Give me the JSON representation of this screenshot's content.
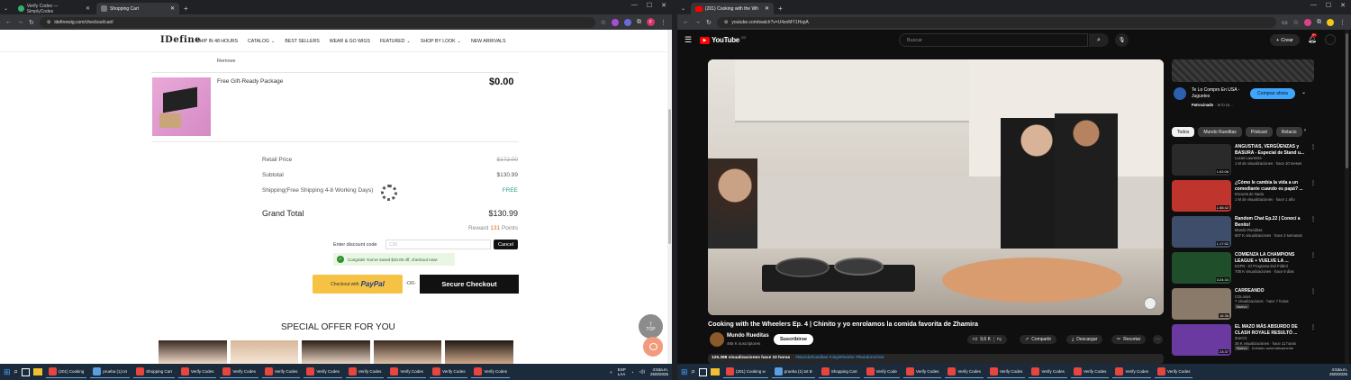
{
  "left_window": {
    "tabs": [
      {
        "title": "Verify Codes — SimplyCodes"
      },
      {
        "title": "Shopping Cart"
      }
    ],
    "url": "idefinewig.com/checkout/cart/",
    "profile_initial": "F"
  },
  "site": {
    "logo": "IDefine",
    "nav": [
      "SHIP IN 48 HOURS",
      "CATALOG",
      "BEST SELLERS",
      "WEAR & GO WIGS",
      "FEATURED",
      "SHOP BY LOOK",
      "NEW ARRIVALS"
    ]
  },
  "cart": {
    "remove_label": "Remove",
    "item_name": "Free Gift-Ready Package",
    "item_price": "$0.00",
    "retail_label": "Retail Price",
    "retail_value": "$172.00",
    "subtotal_label": "Subtotal",
    "subtotal_value": "$130.99",
    "shipping_label": "Shipping(Free Shipping 4-8 Working Days)",
    "shipping_value": "FREE",
    "grand_label": "Grand Total",
    "grand_value": "$130.99",
    "reward_prefix": "Reward",
    "reward_points": "131",
    "reward_suffix": "Points",
    "discount_label": "Enter discount code",
    "discount_value": "C30",
    "cancel_label": "Cancel",
    "success_msg": "Congrats! You've saved $10.00 off, checkout now!",
    "paypal_prefix": "Checkout with",
    "paypal_brand": "PayPal",
    "or_label": "-OR-",
    "checkout_label": "Secure Checkout",
    "special_offer": "SPECIAL OFFER FOR YOU",
    "top_label": "TOP"
  },
  "right_window": {
    "tabs": [
      {
        "title": "(201) Cooking with the Wh"
      }
    ],
    "url": "youtube.com/watch?v=U4znMY1HxpA",
    "notif_count": "9+"
  },
  "youtube": {
    "logo": "YouTube",
    "country": "CO",
    "search_placeholder": "Buscar",
    "create_label": "Crear",
    "video_title": "Cooking with the Wheelers Ep. 4 | Chinito y yo enrolamos la comida favorita de Zhamira",
    "channel": "Mundo Rueditas",
    "subs": "466 K suscriptores",
    "subscribe": "Suscribirse",
    "likes": "9,6 K",
    "share": "Compartir",
    "download": "Descargar",
    "clip": "Recortar",
    "views": "125.398 visualizaciones  hace 10 horas",
    "hashtags": "#MundoRueditas #JayWheeler #RandomChat",
    "ad": {
      "title": "Te Lo Compro En USA - Juguetes",
      "sponsor": "Patrocinado",
      "sponsor_extra": "· te lo co...",
      "button": "Comprar ahora"
    },
    "chips": [
      "Todos",
      "Mundo Rueditas",
      "Pódcast",
      "Relacio"
    ],
    "sidebar": [
      {
        "title": "ANGUSTIAS, VERGÜENZAS y BASURA - Especial de Stand u...",
        "channel": "Lucas Lauriente",
        "meta": "1 M de visualizaciones · hace 10 meses",
        "duration": "1:02:06",
        "color": "#2a2a2a"
      },
      {
        "title": "¿Cómo le cambia la vida a un comediante cuando es papá? ...",
        "channel": "Escuela de Nada",
        "meta": "1 M de visualizaciones · hace 1 año",
        "duration": "1:58:42",
        "color": "#c0342e"
      },
      {
        "title": "Random Chat Ep.22 | Conocí a Benito!",
        "channel": "Mundo Rueditas",
        "meta": "507 K visualizaciones · hace 2 semanas",
        "duration": "1:17:52",
        "color": "#3d4d6a"
      },
      {
        "title": "COMIENZA LA CHAMPIONS LEAGUE + VUELVE LA ...",
        "channel": "ESPN - El Programa Del Fútbol",
        "meta": "708 K visualizaciones · hace 9 días",
        "duration": "3:24:34",
        "color": "#1f4f2a"
      },
      {
        "title": "CARREANDO",
        "channel": "COLosus",
        "meta": "7 visualizaciones · hace 7 horas",
        "duration": "16:36",
        "color": "#8a7a6a",
        "badge": "Nuevo"
      },
      {
        "title": "EL MAZO MÁS ABSURDO DE CLASH ROYALE RESULTÓ ...",
        "channel": "ZoeCG",
        "meta": "36 K visualizaciones · hace 11 horas",
        "duration": "23:37",
        "color": "#6a3aa0",
        "badge": "Nuevo",
        "extra": "Doblado automáticamente"
      }
    ]
  },
  "taskbar_left": {
    "apps": [
      "(201) Cooking",
      "prueba (1).txt",
      "Shopping Cart",
      "Verify Codes",
      "Verify Codes",
      "Verify Codes",
      "Verify Codes",
      "Verify Codes",
      "Verify Codes",
      "Verify Codes",
      "Verify Codes"
    ],
    "lang1": "ESP",
    "lang2": "LAA",
    "time": "4:53a.m.",
    "date": "25/8/2025"
  },
  "taskbar_right": {
    "apps": [
      "(201) Cooking w",
      "prueba (1).txt B",
      "Shopping Cart",
      "Verify Code",
      "Verify Codes",
      "Verify Codes",
      "Verify Codes",
      "Verify Codes",
      "Verify Codes",
      "Verify Codes",
      "Verify Codes"
    ],
    "time": "4:53a.m.",
    "date": "25/8/2025"
  }
}
